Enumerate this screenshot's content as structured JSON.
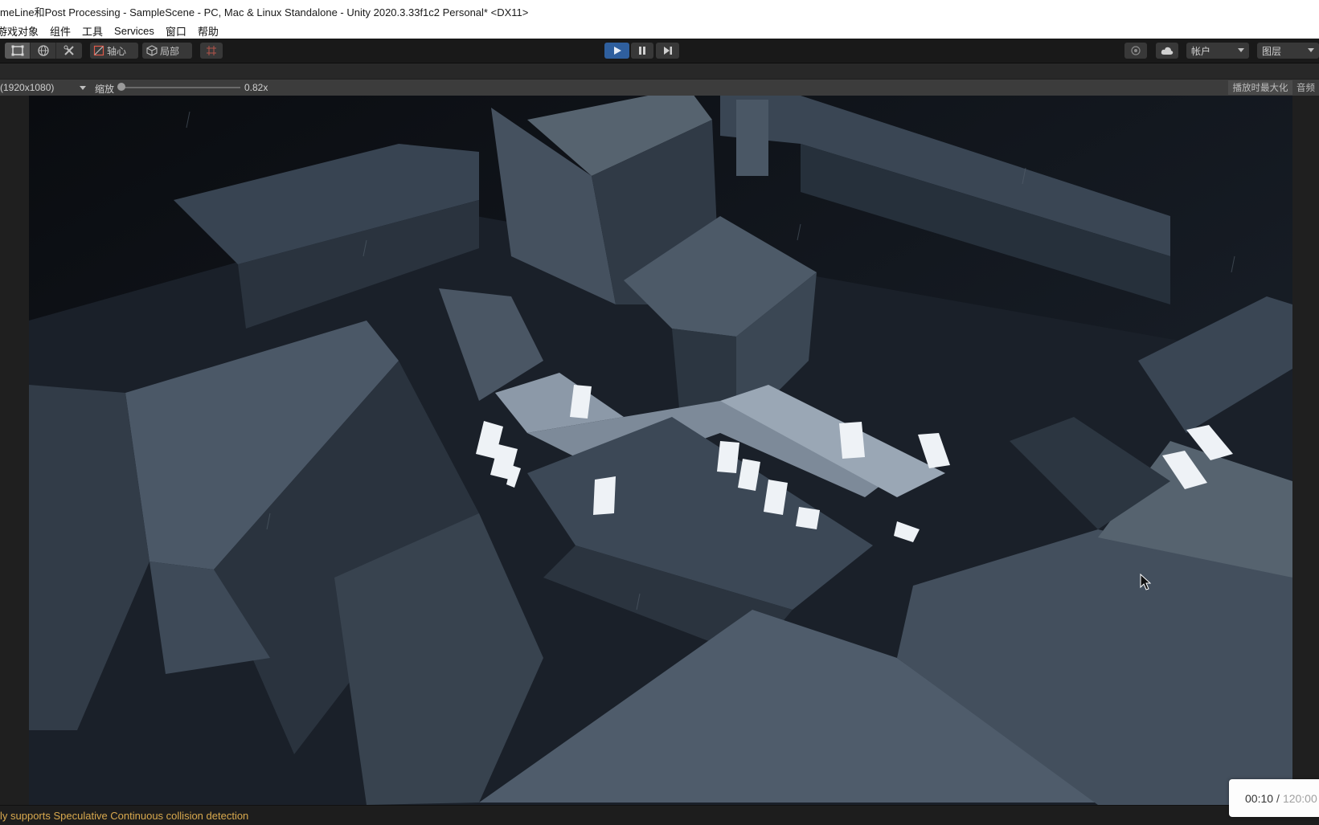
{
  "window": {
    "title": "meLine和Post Processing - SampleScene - PC, Mac & Linux Standalone - Unity 2020.3.33f1c2 Personal* <DX11>"
  },
  "menu": {
    "items": [
      "游戏对象",
      "组件",
      "工具",
      "Services",
      "窗口",
      "帮助"
    ]
  },
  "toolbar": {
    "pivot_label": "轴心",
    "local_label": "局部",
    "account_label": "帐户",
    "layers_label": "图层",
    "play_state": "playing"
  },
  "game_view": {
    "resolution": "(1920x1080)",
    "scale_label": "缩放",
    "scale_value": "0.82x",
    "scale_fraction": 0.0,
    "maximize_label": "播放时最大化",
    "audio_label": "音频"
  },
  "status": {
    "message": "ly supports Speculative Continuous collision detection"
  },
  "timer": {
    "current": "00:10",
    "separator": "/",
    "total": "120:00"
  },
  "colors": {
    "play_active": "#2f5f9e",
    "status_warning": "#d9a94e",
    "editor_bg": "#191919"
  }
}
